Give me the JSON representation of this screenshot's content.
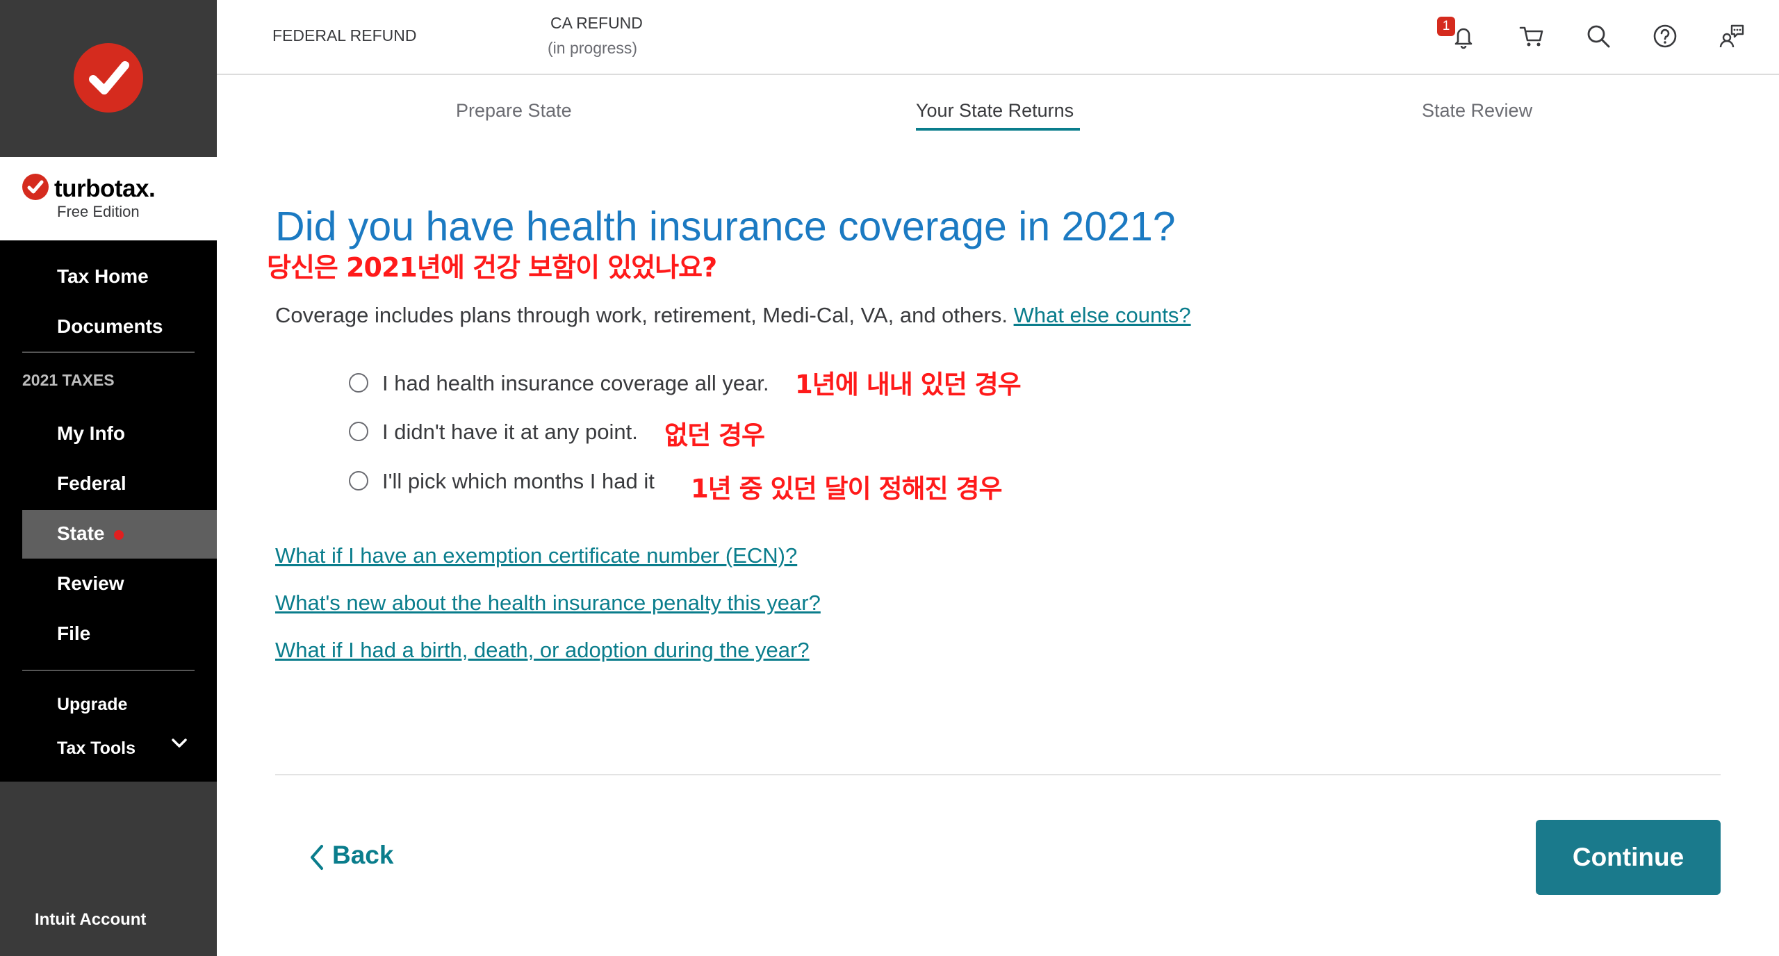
{
  "brand": {
    "name": "turbotax.",
    "edition": "Free Edition"
  },
  "sidebar": {
    "items": [
      {
        "label": "Tax Home"
      },
      {
        "label": "Documents"
      },
      {
        "label": "My Info"
      },
      {
        "label": "Federal"
      },
      {
        "label": "State"
      },
      {
        "label": "Review"
      },
      {
        "label": "File"
      },
      {
        "label": "Upgrade"
      },
      {
        "label": "Tax Tools"
      }
    ],
    "section_label": "2021 TAXES",
    "active_item": "State",
    "account_label": "Intuit Account"
  },
  "header": {
    "federal": "FEDERAL REFUND",
    "ca": "CA REFUND",
    "ca_status": "(in progress)",
    "notification_count": "1",
    "icons": [
      "bell-icon",
      "cart-icon",
      "search-icon",
      "help-icon",
      "chat-icon"
    ]
  },
  "tabs": [
    {
      "label": "Prepare State",
      "active": false
    },
    {
      "label": "Your State Returns",
      "active": true
    },
    {
      "label": "State Review",
      "active": false
    }
  ],
  "question": {
    "title": "Did you have health insurance coverage in 2021?",
    "title_annotation": "당신은 2021년에 건강 보함이 있었나요?",
    "coverage_text": "Coverage includes plans through work, retirement, Medi-Cal, VA, and others.",
    "coverage_link": "What else counts?",
    "options": [
      {
        "label": "I had health insurance coverage all year.",
        "annotation": "1년에 내내 있던 경우"
      },
      {
        "label": "I didn't have it at any point.",
        "annotation": "없던 경우"
      },
      {
        "label": "I'll pick which months I had it",
        "annotation": "1년 중 있던 달이 정해진 경우"
      }
    ]
  },
  "help_links": [
    "What if I have an exemption certificate number (ECN)?",
    "What's new about the health insurance penalty this year?",
    "What if I had a birth, death, or adoption during the year?"
  ],
  "footer": {
    "back_label": "Back",
    "continue_label": "Continue"
  },
  "colors": {
    "brand_red": "#d52b1e",
    "title_blue": "#1b7ac2",
    "teal": "#0a7d8c",
    "button_teal": "#1a7a8c",
    "annotation_red": "#ff1a1a"
  }
}
